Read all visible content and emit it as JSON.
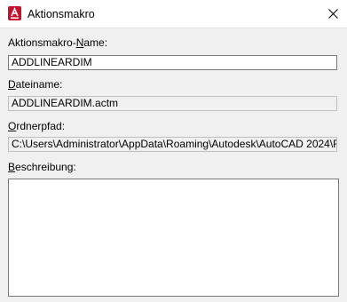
{
  "window": {
    "title": "Aktionsmakro",
    "icon": "autocad-app-icon",
    "close_icon": "close-icon"
  },
  "form": {
    "name_label_pre": "Aktionsmakro-",
    "name_label_mnemonic": "N",
    "name_label_post": "ame:",
    "name_value": "ADDLINEARDIM",
    "file_label_mnemonic": "D",
    "file_label_post": "ateiname:",
    "file_value": "ADDLINEARDIM.actm",
    "folder_label_mnemonic": "O",
    "folder_label_post": "rdnerpfad:",
    "folder_value": "C:\\Users\\Administrator\\AppData\\Roaming\\Autodesk\\AutoCAD 2024\\R",
    "desc_label_mnemonic": "B",
    "desc_label_post": "eschreibung:",
    "desc_value": ""
  }
}
